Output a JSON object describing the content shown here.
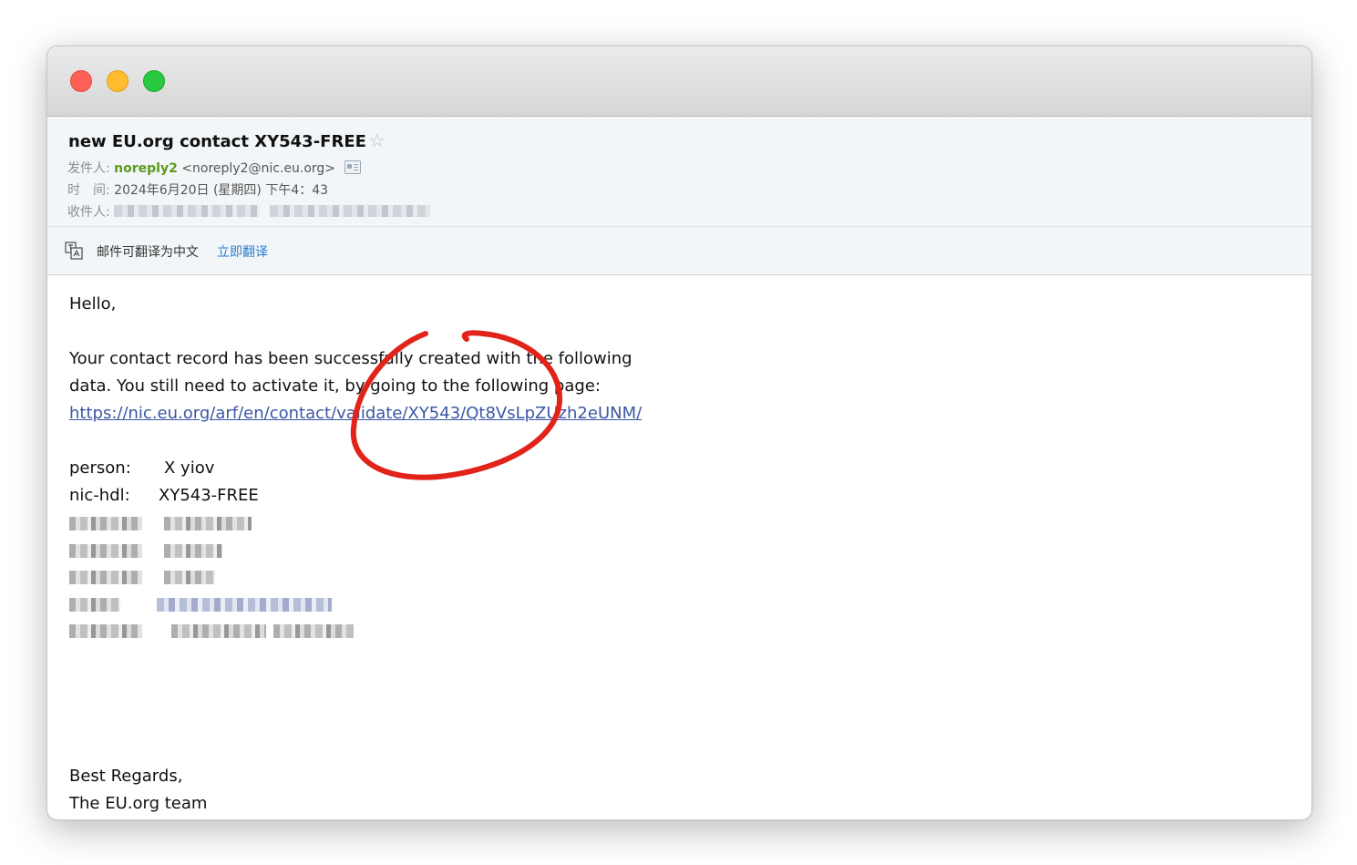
{
  "window": {
    "controls": [
      "close",
      "minimize",
      "maximize"
    ]
  },
  "email": {
    "subject": "new EU.org contact XY543-FREE",
    "star_glyph": "☆",
    "from_label": "发件人:",
    "sender_name": "noreply2",
    "sender_addr": "<noreply2@nic.eu.org>",
    "time_label": "时　间:",
    "time_value": "2024年6月20日 (星期四) 下午4：43",
    "to_label": "收件人:"
  },
  "translate_bar": {
    "text": "邮件可翻译为中文",
    "action": "立即翻译"
  },
  "body": {
    "greeting": "Hello,",
    "line1": "Your contact record has been successfully created with the following",
    "line2": "data. You still need to activate it, by going to the following page:",
    "activation_link": "https://nic.eu.org/arf/en/contact/validate/XY543/Qt8VsLpZUzh2eUNM/",
    "person_label": "person:",
    "person_value": "X yiov",
    "nichdl_label": "nic-hdl:",
    "nichdl_value": "XY543-FREE",
    "sign_off": "Best Regards,",
    "signature": "The EU.org team"
  },
  "colors": {
    "sender_green": "#5c9a1c",
    "link_blue": "#3b57a6",
    "translate_link": "#2a7ad2",
    "annotation_red": "#e2231a"
  }
}
